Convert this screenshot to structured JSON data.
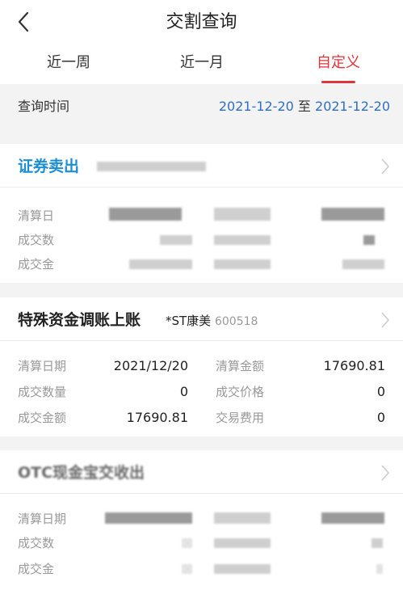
{
  "header": {
    "title": "交割查询",
    "tabs": [
      "近一周",
      "近一月",
      "自定义"
    ],
    "active_tab": "自定义",
    "accent_color": "#e2343b"
  },
  "date_filter": {
    "label": "查询时间",
    "start": "2021-12-20",
    "separator": "至",
    "end": "2021-12-20",
    "link_color": "#2f6fc1"
  },
  "records": [
    {
      "title": "证券卖出",
      "title_color": "#1c8ed6",
      "labels": [
        "清算日",
        "成交数",
        "成交金"
      ]
    },
    {
      "title": "特殊资金调账上账",
      "stock_name": "*ST康美",
      "stock_code": "600518",
      "labels": [
        "清算日期",
        "成交数量",
        "成交金额",
        "清算金额",
        "成交价格",
        "交易费用"
      ],
      "values": [
        "2021/12/20",
        "0",
        "17690.81",
        "17690.81",
        "0",
        "0"
      ]
    },
    {
      "title": "OTC现金宝交收出",
      "labels": [
        "清算日期",
        "成交数",
        "成交金"
      ]
    }
  ]
}
